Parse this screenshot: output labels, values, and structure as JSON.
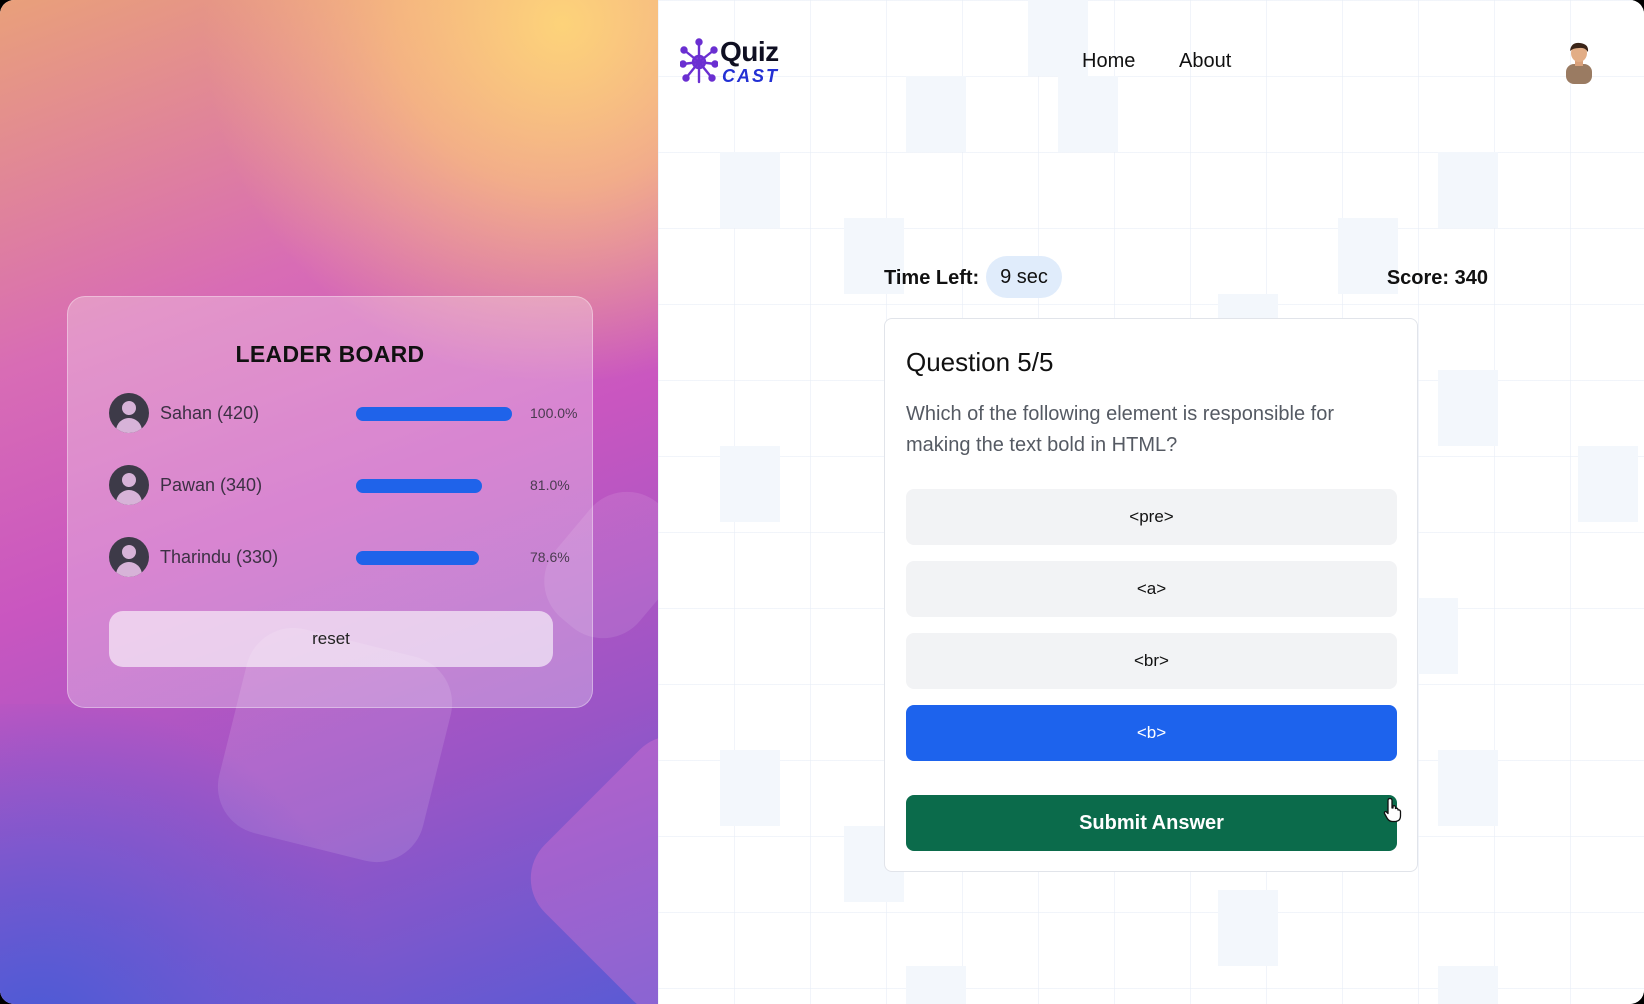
{
  "leaderboard": {
    "title": "LEADER BOARD",
    "players": [
      {
        "name": "Sahan (420)",
        "percent_label": "100.0%",
        "percent": 100.0
      },
      {
        "name": "Pawan (340)",
        "percent_label": "81.0%",
        "percent": 81.0
      },
      {
        "name": "Tharindu (330)",
        "percent_label": "78.6%",
        "percent": 78.6
      }
    ],
    "reset_label": "reset"
  },
  "header": {
    "logo_top": "Quiz",
    "logo_bottom": "CAST",
    "nav": {
      "home": "Home",
      "about": "About"
    }
  },
  "quiz": {
    "time_label": "Time Left:",
    "time_value": "9 sec",
    "score_label": "Score: 340",
    "question_title": "Question 5/5",
    "question_text": "Which of the following element is responsible for making the text bold in HTML?",
    "options": [
      "<pre>",
      "<a>",
      "<br>",
      "<b>"
    ],
    "selected_option": 3,
    "submit_label": "Submit Answer"
  },
  "colors": {
    "accent_blue": "#1d63ed",
    "submit_green": "#0b6b4b",
    "bar_blue": "#1f63ea"
  },
  "icons": {
    "logo": "brain-icon",
    "user": "user-avatar-icon",
    "player": "person-icon",
    "cursor": "hand-pointer-icon"
  }
}
